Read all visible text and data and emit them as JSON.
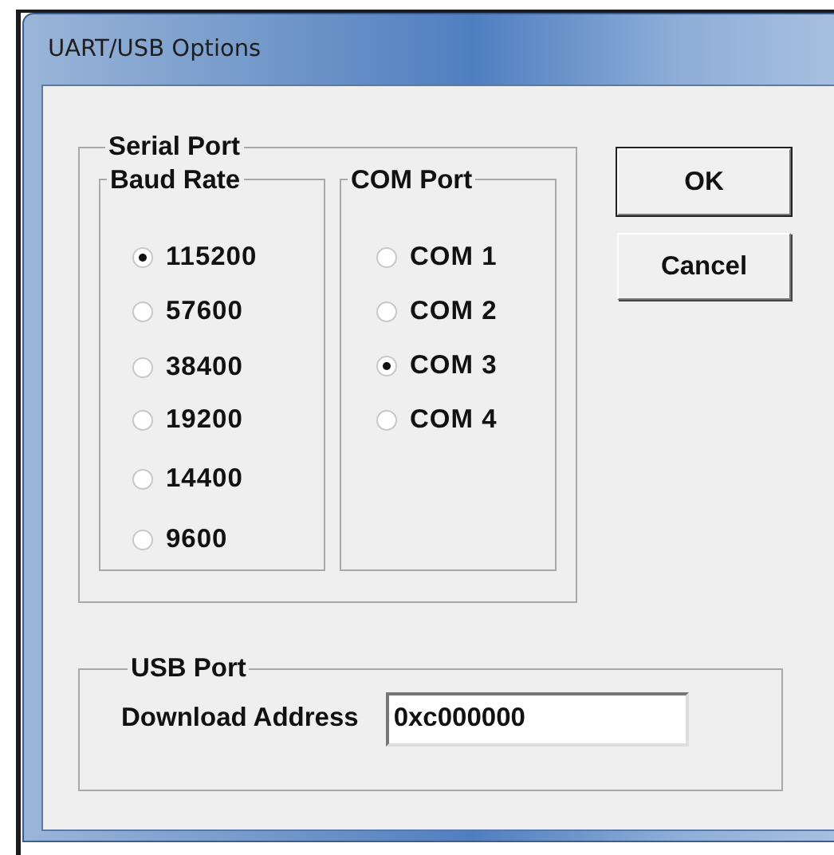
{
  "window": {
    "title": "UART/USB Options"
  },
  "serial_port": {
    "label": "Serial Port",
    "baud_rate": {
      "label": "Baud Rate",
      "options": [
        {
          "label": "115200",
          "selected": true
        },
        {
          "label": "57600",
          "selected": false
        },
        {
          "label": "38400",
          "selected": false
        },
        {
          "label": "19200",
          "selected": false
        },
        {
          "label": "14400",
          "selected": false
        },
        {
          "label": "9600",
          "selected": false
        }
      ]
    },
    "com_port": {
      "label": "COM Port",
      "options": [
        {
          "label": "COM 1",
          "selected": false
        },
        {
          "label": "COM 2",
          "selected": false
        },
        {
          "label": "COM 3",
          "selected": true
        },
        {
          "label": "COM 4",
          "selected": false
        }
      ]
    }
  },
  "usb_port": {
    "label": "USB Port",
    "download_address": {
      "label": "Download Address",
      "value": "0xc000000"
    }
  },
  "buttons": [
    "OK",
    "Cancel"
  ]
}
